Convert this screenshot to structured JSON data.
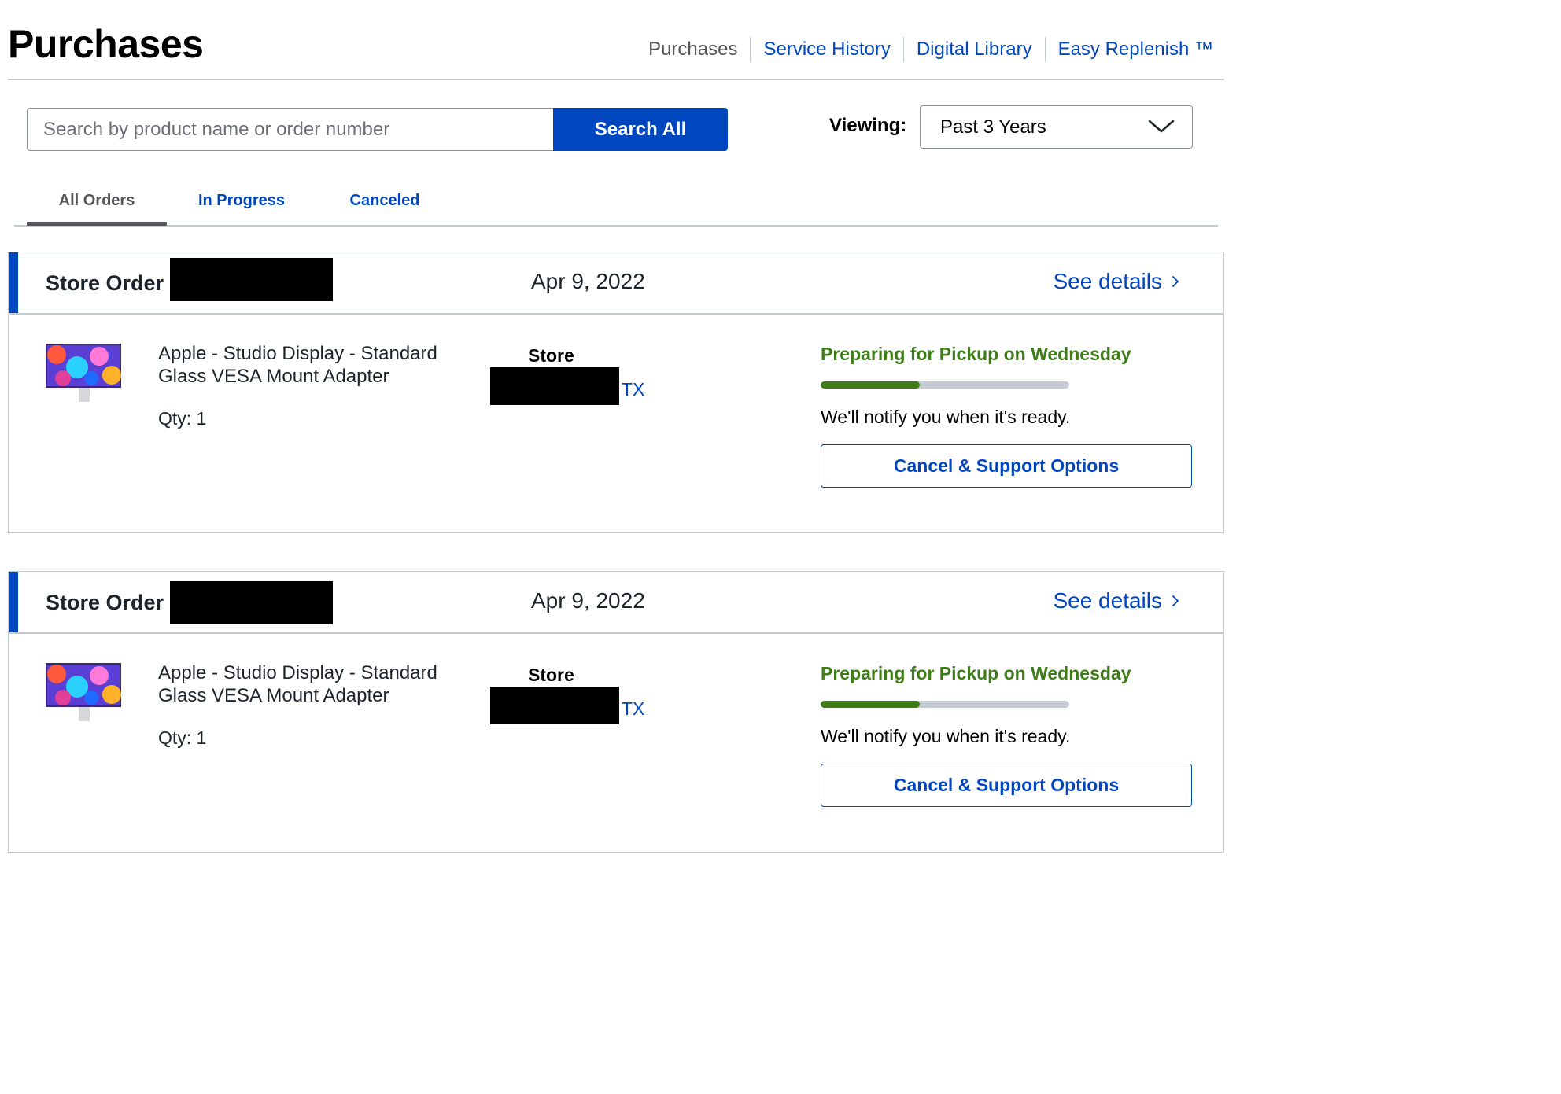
{
  "page": {
    "title": "Purchases"
  },
  "nav": {
    "items": [
      {
        "label": "Purchases",
        "current": true
      },
      {
        "label": "Service History",
        "current": false
      },
      {
        "label": "Digital Library",
        "current": false
      },
      {
        "label": "Easy Replenish ™",
        "current": false
      }
    ]
  },
  "search": {
    "placeholder": "Search by product name or order number",
    "value": "",
    "button_label": "Search All"
  },
  "filter": {
    "label": "Viewing:",
    "selected": "Past 3 Years"
  },
  "tabs": [
    {
      "label": "All Orders",
      "active": true
    },
    {
      "label": "In Progress",
      "active": false
    },
    {
      "label": "Canceled",
      "active": false
    }
  ],
  "orders": [
    {
      "order_label": "Store Order",
      "date": "Apr 9, 2022",
      "details_label": "See details",
      "product_name": "Apple - Studio Display - Standard Glass VESA Mount Adapter",
      "qty": "Qty: 1",
      "store_label": "Store",
      "store_state": "TX",
      "status": "Preparing for Pickup on Wednesday",
      "progress": 0.4,
      "notify": "We'll notify you when it's ready.",
      "action_label": "Cancel & Support Options"
    },
    {
      "order_label": "Store Order",
      "date": "Apr 9, 2022",
      "details_label": "See details",
      "product_name": "Apple - Studio Display - Standard Glass VESA Mount Adapter",
      "qty": "Qty: 1",
      "store_label": "Store",
      "store_state": "TX",
      "status": "Preparing for Pickup on Wednesday",
      "progress": 0.4,
      "notify": "We'll notify you when it's ready.",
      "action_label": "Cancel & Support Options"
    }
  ],
  "colors": {
    "brand_blue": "#0046be",
    "status_green": "#3e7c17",
    "rule_gray": "#c5cbd5"
  },
  "icons": {
    "chevron_down": "chevron-down-icon",
    "chevron_right": "chevron-right-icon",
    "product": "studio-display-thumbnail"
  }
}
